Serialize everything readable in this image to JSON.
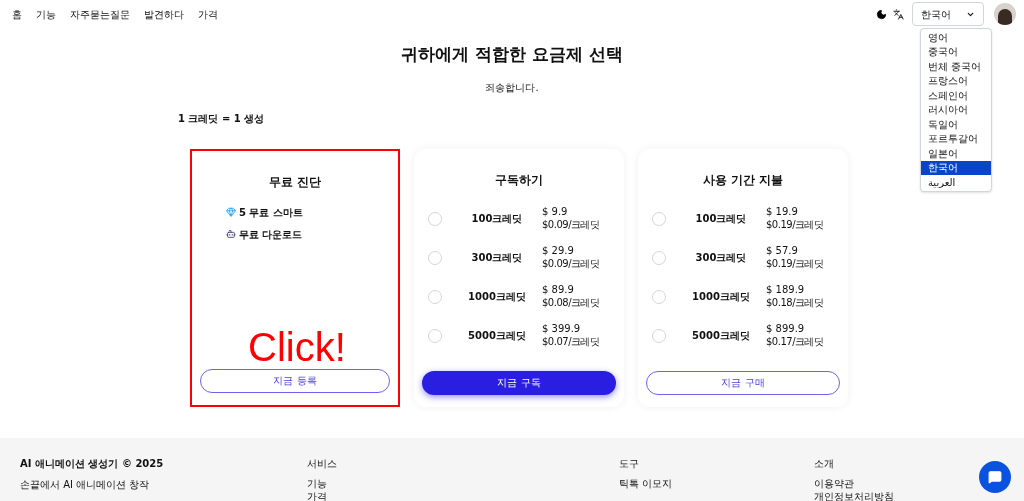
{
  "nav": {
    "items": [
      "홈",
      "기능",
      "자주묻는질문",
      "발견하다",
      "가격"
    ]
  },
  "language_select": {
    "value": "한국어",
    "options": [
      {
        "label": "영어",
        "selected": false
      },
      {
        "label": "중국어",
        "selected": false
      },
      {
        "label": "번체 중국어",
        "selected": false
      },
      {
        "label": "프랑스어",
        "selected": false
      },
      {
        "label": "스페인어",
        "selected": false
      },
      {
        "label": "러시아어",
        "selected": false
      },
      {
        "label": "독일어",
        "selected": false
      },
      {
        "label": "포르투갈어",
        "selected": false
      },
      {
        "label": "일본어",
        "selected": false
      },
      {
        "label": "한국어",
        "selected": true
      },
      {
        "label": "العربية",
        "selected": false
      }
    ]
  },
  "title": "귀하에게 적합한 요금제 선택",
  "subtitle": "죄송합니다.",
  "credit_note": "1 크레딧 = 1 생성",
  "plans": [
    {
      "kind": "free",
      "title": "무료 진단",
      "highlighted": true,
      "features": [
        {
          "text": "5 무료 스마트"
        },
        {
          "text": "무료 다운로드"
        }
      ],
      "button": {
        "label": "지금 등록",
        "primary": false
      }
    },
    {
      "kind": "packages",
      "title": "구독하기",
      "highlighted": false,
      "options": [
        {
          "credits": "100크레딧",
          "price": "$ 9.9",
          "unit_price": "$0.09/크레딧",
          "selected": false
        },
        {
          "credits": "300크레딧",
          "price": "$ 29.9",
          "unit_price": "$0.09/크레딧",
          "selected": false
        },
        {
          "credits": "1000크레딧",
          "price": "$ 89.9",
          "unit_price": "$0.08/크레딧",
          "selected": false
        },
        {
          "credits": "5000크레딧",
          "price": "$ 399.9",
          "unit_price": "$0.07/크레딧",
          "selected": false
        }
      ],
      "button": {
        "label": "지금 구독",
        "primary": true
      }
    },
    {
      "kind": "packages",
      "title": "사용 기간 지불",
      "highlighted": false,
      "options": [
        {
          "credits": "100크레딧",
          "price": "$ 19.9",
          "unit_price": "$0.19/크레딧",
          "selected": false
        },
        {
          "credits": "300크레딧",
          "price": "$ 57.9",
          "unit_price": "$0.19/크레딧",
          "selected": false
        },
        {
          "credits": "1000크레딧",
          "price": "$ 189.9",
          "unit_price": "$0.18/크레딧",
          "selected": false
        },
        {
          "credits": "5000크레딧",
          "price": "$ 899.9",
          "unit_price": "$0.17/크레딧",
          "selected": false
        }
      ],
      "button": {
        "label": "지금 구매",
        "primary": false
      }
    }
  ],
  "annotation": {
    "text": "Click!"
  },
  "footer": {
    "brand": "AI 애니메이션 생성기 © 2025",
    "tagline": "손끝에서 AI 애니메이션 창작",
    "columns": [
      {
        "heading": "서비스",
        "links": [
          "기능",
          "가격"
        ]
      },
      {
        "heading": "도구",
        "links": [
          "틱톡 이모지"
        ]
      },
      {
        "heading": "소개",
        "links": [
          "이용약관",
          "개인정보처리방침"
        ]
      }
    ]
  }
}
